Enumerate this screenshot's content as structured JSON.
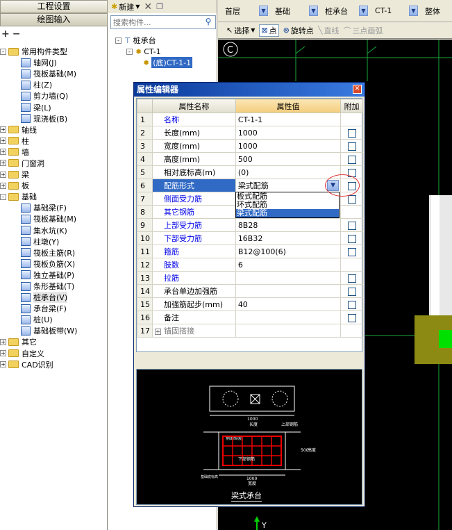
{
  "nav": {
    "project_settings": "工程设置",
    "drawing_input": "绘图输入"
  },
  "left_tree": [
    {
      "expander": "-",
      "kind": "folder",
      "label": "常用构件类型",
      "indent": 0
    },
    {
      "expander": "",
      "kind": "icon",
      "label": "轴网(J)",
      "indent": 2
    },
    {
      "expander": "",
      "kind": "icon",
      "label": "筏板基础(M)",
      "indent": 2
    },
    {
      "expander": "",
      "kind": "icon",
      "label": "柱(Z)",
      "indent": 2
    },
    {
      "expander": "",
      "kind": "icon",
      "label": "剪力墙(Q)",
      "indent": 2
    },
    {
      "expander": "",
      "kind": "icon",
      "label": "梁(L)",
      "indent": 2
    },
    {
      "expander": "",
      "kind": "icon",
      "label": "现浇板(B)",
      "indent": 2
    },
    {
      "expander": "+",
      "kind": "folder",
      "label": "轴线",
      "indent": 0
    },
    {
      "expander": "+",
      "kind": "folder",
      "label": "柱",
      "indent": 0
    },
    {
      "expander": "+",
      "kind": "folder",
      "label": "墙",
      "indent": 0
    },
    {
      "expander": "+",
      "kind": "folder",
      "label": "门窗洞",
      "indent": 0
    },
    {
      "expander": "+",
      "kind": "folder",
      "label": "梁",
      "indent": 0
    },
    {
      "expander": "+",
      "kind": "folder",
      "label": "板",
      "indent": 0
    },
    {
      "expander": "-",
      "kind": "folder",
      "label": "基础",
      "indent": 0
    },
    {
      "expander": "",
      "kind": "icon",
      "label": "基础梁(F)",
      "indent": 2
    },
    {
      "expander": "",
      "kind": "icon",
      "label": "筏板基础(M)",
      "indent": 2
    },
    {
      "expander": "",
      "kind": "icon",
      "label": "集水坑(K)",
      "indent": 2
    },
    {
      "expander": "",
      "kind": "icon",
      "label": "柱墩(Y)",
      "indent": 2
    },
    {
      "expander": "",
      "kind": "icon",
      "label": "筏板主筋(R)",
      "indent": 2
    },
    {
      "expander": "",
      "kind": "icon",
      "label": "筏板负筋(X)",
      "indent": 2
    },
    {
      "expander": "",
      "kind": "icon",
      "label": "独立基础(P)",
      "indent": 2
    },
    {
      "expander": "",
      "kind": "icon",
      "label": "条形基础(T)",
      "indent": 2
    },
    {
      "expander": "",
      "kind": "icon",
      "label": "桩承台(V)",
      "indent": 2,
      "selected": true
    },
    {
      "expander": "",
      "kind": "icon",
      "label": "承台梁(F)",
      "indent": 2
    },
    {
      "expander": "",
      "kind": "icon",
      "label": "桩(U)",
      "indent": 2
    },
    {
      "expander": "",
      "kind": "icon",
      "label": "基础板带(W)",
      "indent": 2
    },
    {
      "expander": "+",
      "kind": "folder",
      "label": "其它",
      "indent": 0
    },
    {
      "expander": "+",
      "kind": "folder",
      "label": "自定义",
      "indent": 0
    },
    {
      "expander": "+",
      "kind": "folder",
      "label": "CAD识别",
      "indent": 0
    }
  ],
  "mid": {
    "new_label": "新建",
    "search_placeholder": "搜索构件...",
    "tree_root": "桩承台",
    "tree_child": "CT-1",
    "tree_leaf": "(底)CT-1-1"
  },
  "topbar": {
    "floor": "首层",
    "category": "基础",
    "type": "桩承台",
    "component": "CT-1",
    "scope": "整体"
  },
  "draw_toolbar": {
    "select": "选择",
    "point": "点",
    "rotate_point": "旋转点",
    "line": "直线",
    "arc": "三点画弧"
  },
  "dialog": {
    "title": "属性编辑器",
    "col_name": "属性名称",
    "col_value": "属性值",
    "col_add": "附加",
    "rows": [
      {
        "no": "1",
        "name": "名称",
        "value": "CT-1-1",
        "blue": true,
        "check": false
      },
      {
        "no": "2",
        "name": "长度(mm)",
        "value": "1000",
        "blue": false,
        "check": true
      },
      {
        "no": "3",
        "name": "宽度(mm)",
        "value": "1000",
        "blue": false,
        "check": true
      },
      {
        "no": "4",
        "name": "高度(mm)",
        "value": "500",
        "blue": false,
        "check": true
      },
      {
        "no": "5",
        "name": "相对底标高(m)",
        "value": "(0)",
        "blue": false,
        "check": true
      },
      {
        "no": "6",
        "name": "配筋形式",
        "value": "梁式配筋",
        "blue": false,
        "check": true,
        "current": true
      },
      {
        "no": "7",
        "name": "侧面受力筋",
        "value": "",
        "blue": true,
        "check": true
      },
      {
        "no": "8",
        "name": "其它钢筋",
        "value": "",
        "blue": true,
        "check": false
      },
      {
        "no": "9",
        "name": "上部受力筋",
        "value": "8B28",
        "blue": true,
        "check": true
      },
      {
        "no": "10",
        "name": "下部受力筋",
        "value": "16B32",
        "blue": true,
        "check": true
      },
      {
        "no": "11",
        "name": "箍筋",
        "value": "B12@100(6)",
        "blue": true,
        "check": true
      },
      {
        "no": "12",
        "name": "肢数",
        "value": "6",
        "blue": true,
        "check": false
      },
      {
        "no": "13",
        "name": "拉筋",
        "value": "",
        "blue": true,
        "check": true
      },
      {
        "no": "14",
        "name": "承台单边加强筋",
        "value": "",
        "blue": false,
        "check": true
      },
      {
        "no": "15",
        "name": "加强筋起步(mm)",
        "value": "40",
        "blue": false,
        "check": true
      },
      {
        "no": "16",
        "name": "备注",
        "value": "",
        "blue": false,
        "check": true
      },
      {
        "no": "17",
        "name": "锚固搭接",
        "value": "",
        "blue": false,
        "check": false,
        "gray": true,
        "expander": "+"
      }
    ],
    "dropdown_options": [
      {
        "label": "板式配筋",
        "highlighted": false
      },
      {
        "label": "环式配筋",
        "highlighted": false
      },
      {
        "label": "梁式配筋",
        "highlighted": true
      }
    ],
    "preview": {
      "caption": "梁式承台",
      "dim_top": "1000",
      "dim_top_label": "长度",
      "dim_bottom": "1000",
      "dim_bottom_label": "宽度",
      "label_side_rebar": "侧面纵筋",
      "label_top_rebar": "上部钢筋",
      "label_bottom_rebar": "下部钢筋",
      "label_left": "基础底标高",
      "label_right": "高度",
      "dim_height": "500"
    }
  },
  "canvas": {
    "axis_label": "C",
    "y_label": "Y"
  },
  "colors": {
    "title_bar": "#0a3a9a",
    "selection": "#316ac5",
    "canvas_bg": "#000000",
    "grid_green": "#1aa83a",
    "column_olive": "#8c8a12"
  }
}
